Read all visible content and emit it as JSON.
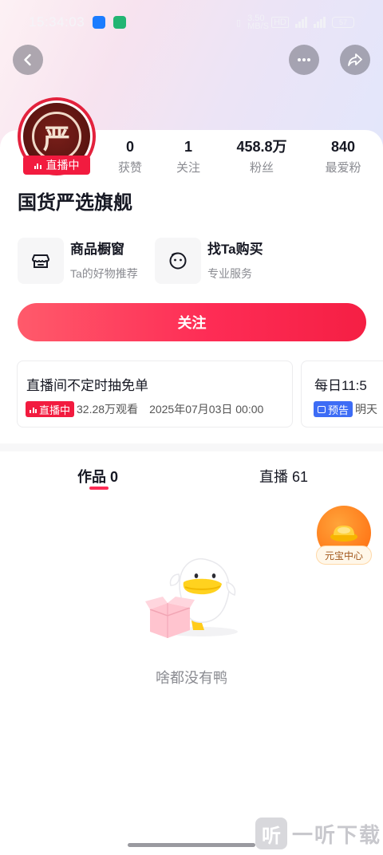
{
  "status_bar": {
    "time": "15:34:03",
    "net_speed": "3.50 MB/S",
    "hd": "HD",
    "signal1": "5G",
    "signal2": "5G",
    "battery": "57"
  },
  "nav": {
    "back_icon": "chevron-left-icon",
    "more_icon": "more-dots-icon",
    "share_icon": "share-icon"
  },
  "profile": {
    "avatar_glyph": "严",
    "live_badge": "直播中",
    "name": "国货严选旗舰"
  },
  "stats": [
    {
      "num": "0",
      "label": "获赞"
    },
    {
      "num": "1",
      "label": "关注"
    },
    {
      "num": "458.8万",
      "label": "粉丝"
    },
    {
      "num": "840",
      "label": "最爱粉"
    }
  ],
  "features": [
    {
      "title": "商品橱窗",
      "subtitle": "Ta的好物推荐",
      "icon": "storefront-icon"
    },
    {
      "title": "找Ta购买",
      "subtitle": "专业服务",
      "icon": "smile-face-icon"
    }
  ],
  "follow_button": "关注",
  "live_cards": [
    {
      "title": "直播间不定时抽免单",
      "tag": "直播中",
      "views": "32.28万观看",
      "datetime": "2025年07月03日 00:00"
    },
    {
      "title": "每日11:5",
      "tag": "预告",
      "extra": "明天"
    }
  ],
  "tabs": [
    {
      "label": "作品 0",
      "active": true
    },
    {
      "label": "直播 61",
      "active": false
    }
  ],
  "coin_center": {
    "label": "元宝中心",
    "icon": "gold-ingot-icon"
  },
  "empty_state": {
    "text": "啥都没有鸭",
    "icon": "duck-empty-box-icon"
  },
  "watermark": {
    "mark": "听",
    "text": "一听下载"
  },
  "colors": {
    "accent": "#fe2c55",
    "live_red": "#f21b3f",
    "preview_blue": "#3d6cf5"
  }
}
